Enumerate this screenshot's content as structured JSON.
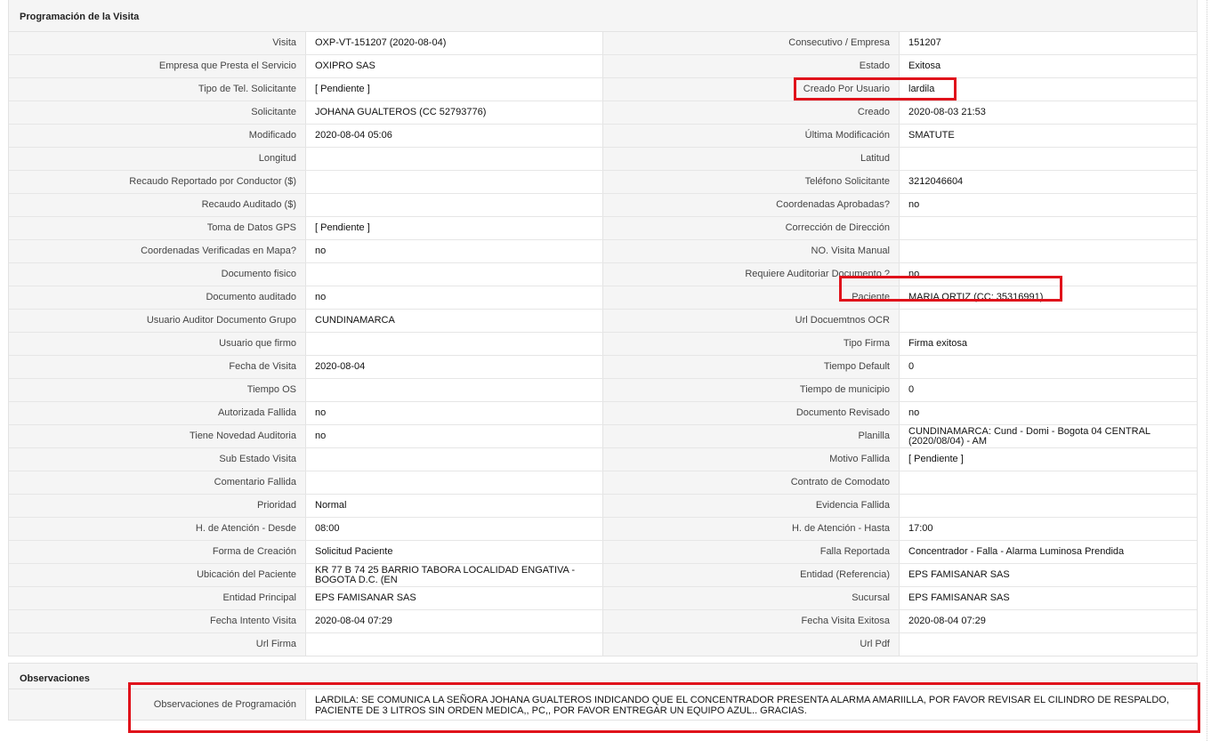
{
  "programacion": {
    "title": "Programación de la Visita",
    "rows": [
      [
        "Visita",
        "OXP-VT-151207 (2020-08-04)",
        "Consecutivo / Empresa",
        "151207"
      ],
      [
        "Empresa que Presta el Servicio",
        "OXIPRO SAS",
        "Estado",
        "Exitosa"
      ],
      [
        "Tipo de Tel. Solicitante",
        "[ Pendiente ]",
        "Creado Por Usuario",
        "lardila"
      ],
      [
        "Solicitante",
        "JOHANA GUALTEROS (CC 52793776)",
        "Creado",
        "2020-08-03 21:53"
      ],
      [
        "Modificado",
        "2020-08-04 05:06",
        "Última Modificación",
        " SMATUTE"
      ],
      [
        "Longitud",
        "",
        "Latitud",
        ""
      ],
      [
        "Recaudo Reportado por Conductor ($)",
        "",
        "Teléfono Solicitante",
        "3212046604"
      ],
      [
        "Recaudo Auditado ($)",
        "",
        "Coordenadas Aprobadas?",
        " no"
      ],
      [
        "Toma de Datos GPS",
        "[ Pendiente ]",
        "Corrección de Dirección",
        ""
      ],
      [
        "Coordenadas Verificadas en Mapa?",
        " no",
        "NO. Visita Manual",
        ""
      ],
      [
        "Documento fisico",
        "",
        "Requiere Auditoriar Documento ?",
        " no"
      ],
      [
        "Documento auditado",
        " no",
        "Paciente",
        "MARIA ORTIZ (CC: 35316991)"
      ],
      [
        "Usuario Auditor Documento Grupo",
        "CUNDINAMARCA",
        "Url Docuemtnos OCR",
        ""
      ],
      [
        "Usuario que firmo",
        "",
        "Tipo Firma",
        "Firma exitosa"
      ],
      [
        "Fecha de Visita",
        " 2020-08-04",
        "Tiempo Default",
        "0"
      ],
      [
        "Tiempo OS",
        "",
        "Tiempo de municipio",
        "0"
      ],
      [
        "Autorizada Fallida",
        " no",
        "Documento Revisado",
        " no"
      ],
      [
        "Tiene Novedad Auditoria",
        " no",
        "Planilla",
        "CUNDINAMARCA: Cund - Domi - Bogota 04 CENTRAL (2020/08/04) - AM"
      ],
      [
        "Sub Estado Visita",
        "",
        "Motivo Fallida",
        "[ Pendiente ]"
      ],
      [
        "Comentario Fallida",
        "",
        "Contrato de Comodato",
        ""
      ],
      [
        "Prioridad",
        "Normal",
        "Evidencia Fallida",
        ""
      ],
      [
        "H. de Atención - Desde",
        "08:00",
        "H. de Atención - Hasta",
        "17:00"
      ],
      [
        "Forma de Creación",
        "Solicitud Paciente",
        "Falla Reportada",
        "Concentrador - Falla - Alarma Luminosa Prendida"
      ],
      [
        "Ubicación del Paciente",
        "KR 77 B 74 25 BARRIO TABORA LOCALIDAD ENGATIVA - BOGOTA D.C. (EN",
        "Entidad (Referencia)",
        "EPS FAMISANAR SAS"
      ],
      [
        "Entidad Principal",
        "EPS FAMISANAR SAS",
        "Sucursal",
        "EPS FAMISANAR SAS"
      ],
      [
        "Fecha Intento Visita",
        " 2020-08-04 07:29",
        "Fecha Visita Exitosa",
        " 2020-08-04 07:29"
      ],
      [
        "Url Firma",
        "",
        "Url Pdf",
        ""
      ]
    ]
  },
  "observaciones": {
    "title": "Observaciones",
    "label": "Observaciones de Programación",
    "value": "  LARDILA: SE COMUNICA LA SEÑORA JOHANA GUALTEROS INDICANDO QUE EL CONCENTRADOR PRESENTA ALARMA AMARIILLA, POR FAVOR REVISAR EL CILINDRO DE RESPALDO, PACIENTE DE 3 LITROS SIN ORDEN MEDICA,, PC,, POR FAVOR ENTREGAR UN EQUIPO AZUL.. GRACIAS."
  },
  "highlight_color": "#e0121b"
}
